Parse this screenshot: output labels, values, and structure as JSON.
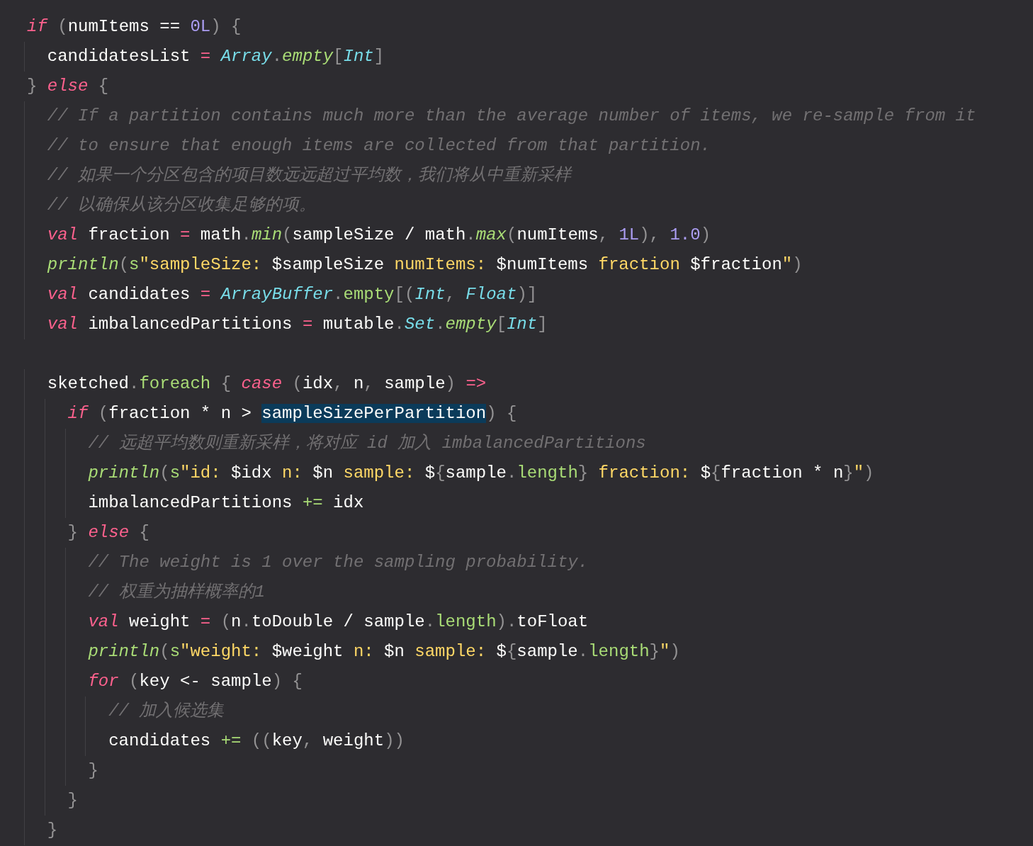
{
  "editor": {
    "lines": [
      {
        "kind": "code",
        "tokens": [
          {
            "kind": "kw",
            "text": "if"
          },
          {
            "kind": "punct",
            "text": " ("
          },
          {
            "kind": "plain",
            "text": "numItems == "
          },
          {
            "kind": "num",
            "text": "0L"
          },
          {
            "kind": "punct",
            "text": ") {"
          }
        ]
      },
      {
        "kind": "code",
        "tokens": [
          {
            "kind": "plain",
            "text": "  candidatesList "
          },
          {
            "kind": "kw",
            "text": "= "
          },
          {
            "kind": "type",
            "text": "Array"
          },
          {
            "kind": "punct",
            "text": "."
          },
          {
            "kind": "fn",
            "text": "empty"
          },
          {
            "kind": "punct",
            "text": "["
          },
          {
            "kind": "type",
            "text": "Int"
          },
          {
            "kind": "punct",
            "text": "]"
          }
        ]
      },
      {
        "kind": "code",
        "tokens": [
          {
            "kind": "punct",
            "text": "} "
          },
          {
            "kind": "kw",
            "text": "else"
          },
          {
            "kind": "punct",
            "text": " {"
          }
        ]
      },
      {
        "kind": "code",
        "tokens": [
          {
            "kind": "cmt",
            "text": "  // If a partition contains much more than the average number of items, we re-sample from it"
          }
        ]
      },
      {
        "kind": "code",
        "tokens": [
          {
            "kind": "cmt",
            "text": "  // to ensure that enough items are collected from that partition."
          }
        ]
      },
      {
        "kind": "code",
        "tokens": [
          {
            "kind": "cmt",
            "text": "  // 如果一个分区包含的项目数远远超过平均数，我们将从中重新采样"
          }
        ]
      },
      {
        "kind": "code",
        "tokens": [
          {
            "kind": "cmt",
            "text": "  // 以确保从该分区收集足够的项。"
          }
        ]
      },
      {
        "kind": "code",
        "tokens": [
          {
            "kind": "kw",
            "text": "  val"
          },
          {
            "kind": "plain",
            "text": " fraction "
          },
          {
            "kind": "kw",
            "text": "="
          },
          {
            "kind": "plain",
            "text": " math"
          },
          {
            "kind": "punct",
            "text": "."
          },
          {
            "kind": "fn",
            "text": "min"
          },
          {
            "kind": "punct",
            "text": "("
          },
          {
            "kind": "plain",
            "text": "sampleSize / math"
          },
          {
            "kind": "punct",
            "text": "."
          },
          {
            "kind": "fn",
            "text": "max"
          },
          {
            "kind": "punct",
            "text": "("
          },
          {
            "kind": "plain",
            "text": "numItems"
          },
          {
            "kind": "punct",
            "text": ", "
          },
          {
            "kind": "num",
            "text": "1L"
          },
          {
            "kind": "punct",
            "text": "), "
          },
          {
            "kind": "num",
            "text": "1.0"
          },
          {
            "kind": "punct",
            "text": ")"
          }
        ]
      },
      {
        "kind": "code",
        "tokens": [
          {
            "kind": "fn",
            "text": "  println"
          },
          {
            "kind": "punct",
            "text": "("
          },
          {
            "kind": "member",
            "text": "s"
          },
          {
            "kind": "str",
            "text": "\"sampleSize:"
          },
          {
            "kind": "plain",
            "text": " $sampleSize "
          },
          {
            "kind": "str",
            "text": "numItems:"
          },
          {
            "kind": "plain",
            "text": " $numItems "
          },
          {
            "kind": "str",
            "text": "fraction"
          },
          {
            "kind": "plain",
            "text": " $fraction"
          },
          {
            "kind": "str",
            "text": "\""
          },
          {
            "kind": "punct",
            "text": ")"
          }
        ]
      },
      {
        "kind": "code",
        "tokens": [
          {
            "kind": "kw",
            "text": "  val"
          },
          {
            "kind": "plain",
            "text": " candidates "
          },
          {
            "kind": "kw",
            "text": "= "
          },
          {
            "kind": "type",
            "text": "ArrayBuffer"
          },
          {
            "kind": "punct",
            "text": "."
          },
          {
            "kind": "member",
            "text": "empty"
          },
          {
            "kind": "punct",
            "text": "[("
          },
          {
            "kind": "type",
            "text": "Int"
          },
          {
            "kind": "punct",
            "text": ", "
          },
          {
            "kind": "type",
            "text": "Float"
          },
          {
            "kind": "punct",
            "text": ")]"
          }
        ]
      },
      {
        "kind": "code",
        "tokens": [
          {
            "kind": "kw",
            "text": "  val"
          },
          {
            "kind": "plain",
            "text": " imbalancedPartitions "
          },
          {
            "kind": "kw",
            "text": "="
          },
          {
            "kind": "plain",
            "text": " mutable"
          },
          {
            "kind": "punct",
            "text": "."
          },
          {
            "kind": "type",
            "text": "Set"
          },
          {
            "kind": "punct",
            "text": "."
          },
          {
            "kind": "fn",
            "text": "empty"
          },
          {
            "kind": "punct",
            "text": "["
          },
          {
            "kind": "type",
            "text": "Int"
          },
          {
            "kind": "punct",
            "text": "]"
          }
        ]
      },
      {
        "kind": "blank"
      },
      {
        "kind": "code",
        "tokens": [
          {
            "kind": "plain",
            "text": "  sketched"
          },
          {
            "kind": "punct",
            "text": "."
          },
          {
            "kind": "member",
            "text": "foreach"
          },
          {
            "kind": "punct",
            "text": " { "
          },
          {
            "kind": "kw",
            "text": "case"
          },
          {
            "kind": "punct",
            "text": " ("
          },
          {
            "kind": "plain",
            "text": "idx"
          },
          {
            "kind": "punct",
            "text": ", "
          },
          {
            "kind": "plain",
            "text": "n"
          },
          {
            "kind": "punct",
            "text": ", "
          },
          {
            "kind": "plain",
            "text": "sample"
          },
          {
            "kind": "punct",
            "text": ") "
          },
          {
            "kind": "kw",
            "text": "=>"
          }
        ]
      },
      {
        "kind": "code",
        "tokens": [
          {
            "kind": "kw",
            "text": "    if"
          },
          {
            "kind": "punct",
            "text": " ("
          },
          {
            "kind": "plain",
            "text": "fraction * n > "
          },
          {
            "kind": "sel",
            "text": "sampleSizePerPartition"
          },
          {
            "kind": "punct",
            "text": ") {"
          }
        ]
      },
      {
        "kind": "code",
        "tokens": [
          {
            "kind": "cmt",
            "text": "      // 远超平均数则重新采样，将对应 id 加入 imbalancedPartitions"
          }
        ]
      },
      {
        "kind": "code",
        "tokens": [
          {
            "kind": "fn",
            "text": "      println"
          },
          {
            "kind": "punct",
            "text": "("
          },
          {
            "kind": "member",
            "text": "s"
          },
          {
            "kind": "str",
            "text": "\"id:"
          },
          {
            "kind": "plain",
            "text": " $idx "
          },
          {
            "kind": "str",
            "text": "n:"
          },
          {
            "kind": "plain",
            "text": " $n "
          },
          {
            "kind": "str",
            "text": "sample:"
          },
          {
            "kind": "plain",
            "text": " $"
          },
          {
            "kind": "punct",
            "text": "{"
          },
          {
            "kind": "plain",
            "text": "sample"
          },
          {
            "kind": "punct",
            "text": "."
          },
          {
            "kind": "member",
            "text": "length"
          },
          {
            "kind": "punct",
            "text": "} "
          },
          {
            "kind": "str",
            "text": "fraction:"
          },
          {
            "kind": "plain",
            "text": " $"
          },
          {
            "kind": "punct",
            "text": "{"
          },
          {
            "kind": "plain",
            "text": "fraction * n"
          },
          {
            "kind": "punct",
            "text": "}"
          },
          {
            "kind": "str",
            "text": "\""
          },
          {
            "kind": "punct",
            "text": ")"
          }
        ]
      },
      {
        "kind": "code",
        "tokens": [
          {
            "kind": "plain",
            "text": "      imbalancedPartitions "
          },
          {
            "kind": "member",
            "text": "+="
          },
          {
            "kind": "plain",
            "text": " idx"
          }
        ]
      },
      {
        "kind": "code",
        "tokens": [
          {
            "kind": "punct",
            "text": "    } "
          },
          {
            "kind": "kw",
            "text": "else"
          },
          {
            "kind": "punct",
            "text": " {"
          }
        ]
      },
      {
        "kind": "code",
        "tokens": [
          {
            "kind": "cmt",
            "text": "      // The weight is 1 over the sampling probability."
          }
        ]
      },
      {
        "kind": "code",
        "tokens": [
          {
            "kind": "cmt",
            "text": "      // 权重为抽样概率的1"
          }
        ]
      },
      {
        "kind": "code",
        "tokens": [
          {
            "kind": "kw",
            "text": "      val"
          },
          {
            "kind": "plain",
            "text": " weight "
          },
          {
            "kind": "kw",
            "text": "="
          },
          {
            "kind": "punct",
            "text": " ("
          },
          {
            "kind": "plain",
            "text": "n"
          },
          {
            "kind": "punct",
            "text": "."
          },
          {
            "kind": "plain",
            "text": "toDouble / sample"
          },
          {
            "kind": "punct",
            "text": "."
          },
          {
            "kind": "member",
            "text": "length"
          },
          {
            "kind": "punct",
            "text": ")."
          },
          {
            "kind": "plain",
            "text": "toFloat"
          }
        ]
      },
      {
        "kind": "code",
        "tokens": [
          {
            "kind": "fn",
            "text": "      println"
          },
          {
            "kind": "punct",
            "text": "("
          },
          {
            "kind": "member",
            "text": "s"
          },
          {
            "kind": "str",
            "text": "\"weight:"
          },
          {
            "kind": "plain",
            "text": " $weight "
          },
          {
            "kind": "str",
            "text": "n:"
          },
          {
            "kind": "plain",
            "text": " $n "
          },
          {
            "kind": "str",
            "text": "sample:"
          },
          {
            "kind": "plain",
            "text": " $"
          },
          {
            "kind": "punct",
            "text": "{"
          },
          {
            "kind": "plain",
            "text": "sample"
          },
          {
            "kind": "punct",
            "text": "."
          },
          {
            "kind": "member",
            "text": "length"
          },
          {
            "kind": "punct",
            "text": "}"
          },
          {
            "kind": "str",
            "text": "\""
          },
          {
            "kind": "punct",
            "text": ")"
          }
        ]
      },
      {
        "kind": "code",
        "tokens": [
          {
            "kind": "kw",
            "text": "      for"
          },
          {
            "kind": "punct",
            "text": " ("
          },
          {
            "kind": "plain",
            "text": "key <- sample"
          },
          {
            "kind": "punct",
            "text": ") {"
          }
        ]
      },
      {
        "kind": "code",
        "tokens": [
          {
            "kind": "cmt",
            "text": "        // 加入候选集"
          }
        ]
      },
      {
        "kind": "code",
        "tokens": [
          {
            "kind": "plain",
            "text": "        candidates "
          },
          {
            "kind": "member",
            "text": "+="
          },
          {
            "kind": "punct",
            "text": " (("
          },
          {
            "kind": "plain",
            "text": "key"
          },
          {
            "kind": "punct",
            "text": ", "
          },
          {
            "kind": "plain",
            "text": "weight"
          },
          {
            "kind": "punct",
            "text": "))"
          }
        ]
      },
      {
        "kind": "code",
        "tokens": [
          {
            "kind": "punct",
            "text": "      }"
          }
        ]
      },
      {
        "kind": "code",
        "tokens": [
          {
            "kind": "punct",
            "text": "    }"
          }
        ]
      },
      {
        "kind": "code",
        "tokens": [
          {
            "kind": "punct",
            "text": "  }"
          }
        ]
      }
    ]
  }
}
